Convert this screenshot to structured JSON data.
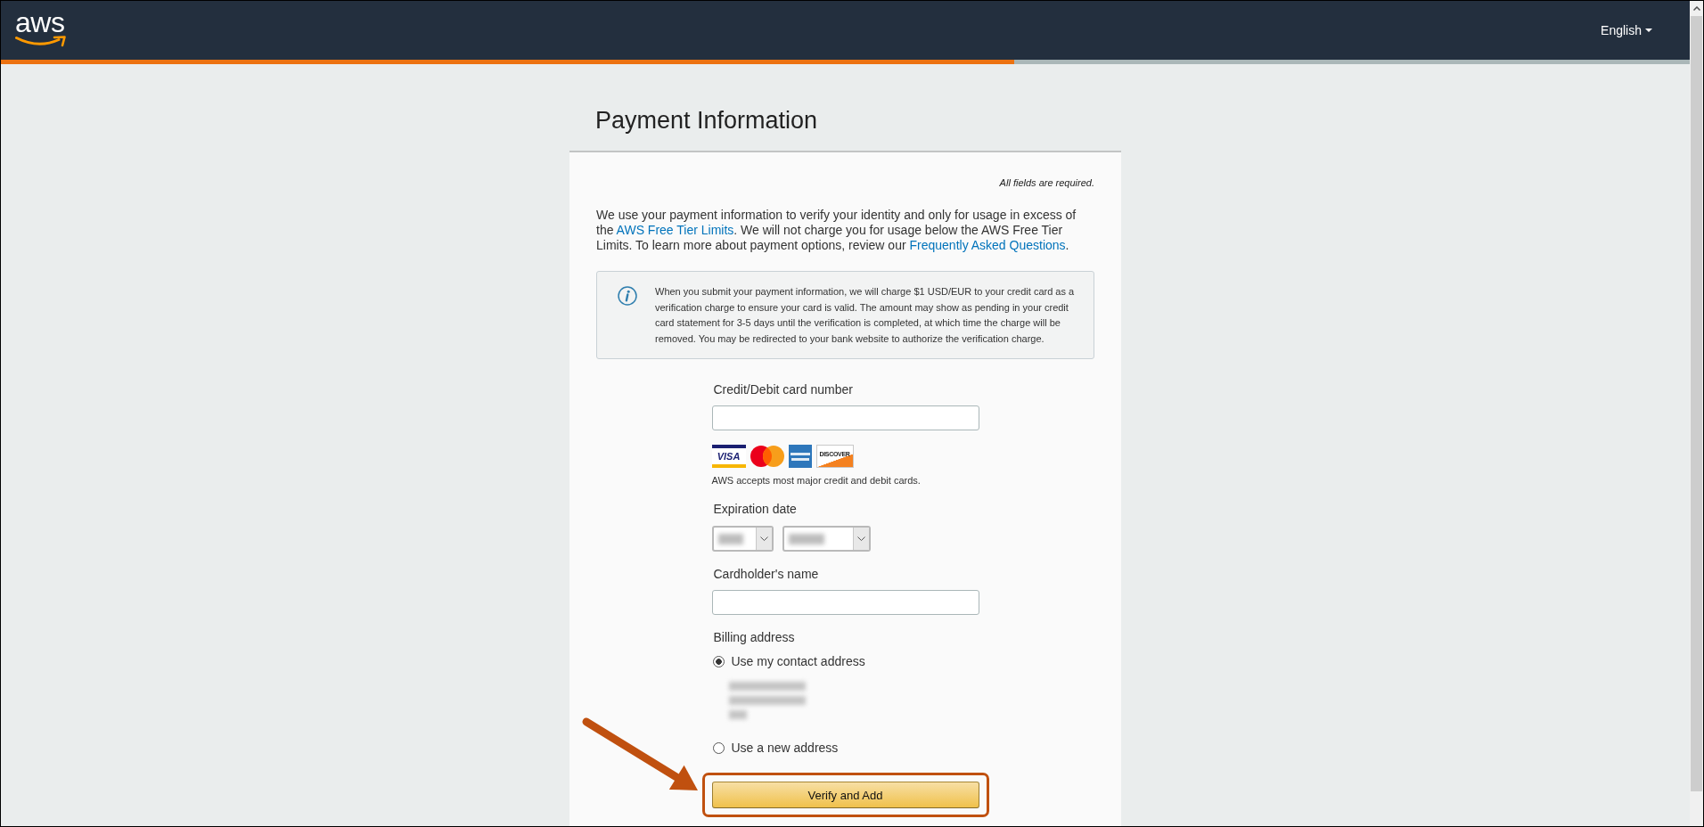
{
  "header": {
    "logo": "aws",
    "language": "English"
  },
  "progress": {
    "level": 0.6
  },
  "title": "Payment Information",
  "required_note": "All fields are required.",
  "intro": [
    {
      "kind": "text",
      "text": "We use your payment information to verify your identity and only for usage in excess of the "
    },
    {
      "kind": "link",
      "text": "AWS Free Tier Limits"
    },
    {
      "kind": "text",
      "text": ". We will not charge you for usage below the AWS Free Tier Limits. To learn more about payment options, review our "
    },
    {
      "kind": "link",
      "text": "Frequently Asked Questions"
    },
    {
      "kind": "text",
      "text": "."
    }
  ],
  "notice": "When you submit your payment information, we will charge $1 USD/EUR to your credit card as a verification charge to ensure your card is valid. The amount may show as pending in your credit card statement for 3-5 days until the verification is completed, at which time the charge will be removed. You may be redirected to your bank website to authorize the verification charge.",
  "card_number": {
    "label": "Credit/Debit card number"
  },
  "card_logos": [
    {
      "kind": "visa",
      "text": "VISA"
    },
    {
      "kind": "mastercard"
    },
    {
      "kind": "amex"
    },
    {
      "kind": "discover",
      "text": "DISCOVER"
    }
  ],
  "cards_note": "AWS accepts most major credit and debit cards.",
  "expiration": {
    "label": "Expiration date",
    "selects": [
      {
        "blurred": true
      },
      {
        "blurred": true
      }
    ]
  },
  "cardholder": {
    "label": "Cardholder's name"
  },
  "billing": {
    "label": "Billing address",
    "options": [
      {
        "label": "Use my contact address",
        "selected": true,
        "address_blurred": true
      },
      {
        "label": "Use a new address",
        "selected": false,
        "address_blurred": false
      }
    ]
  },
  "submit": {
    "label": "Verify and Add",
    "highlighted": true
  }
}
